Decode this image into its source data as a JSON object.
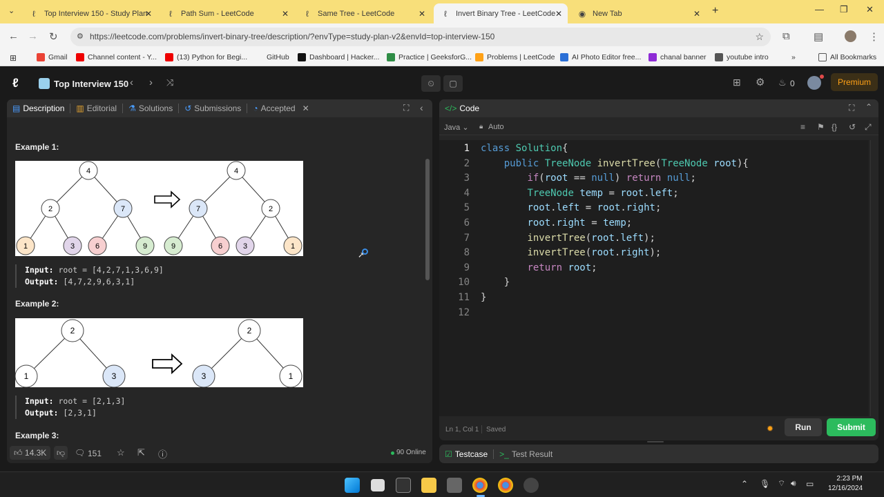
{
  "browser": {
    "tabs": [
      {
        "title": "Top Interview 150 - Study Plan",
        "active": false
      },
      {
        "title": "Path Sum - LeetCode",
        "active": false
      },
      {
        "title": "Same Tree - LeetCode",
        "active": false
      },
      {
        "title": "Invert Binary Tree - LeetCode",
        "active": true
      },
      {
        "title": "New Tab",
        "active": false
      }
    ],
    "url": "https://leetcode.com/problems/invert-binary-tree/description/?envType=study-plan-v2&envId=top-interview-150",
    "bookmarks": [
      "Gmail",
      "Channel content - Y...",
      "(13) Python for Begi...",
      "GitHub",
      "Dashboard | Hacker...",
      "Practice | GeeksforG...",
      "Problems | LeetCode",
      "AI Photo Editor free...",
      "chanal banner",
      "youtube intro"
    ],
    "all_bookmarks": "All Bookmarks"
  },
  "lc_nav": {
    "study_plan": "Top Interview 150",
    "streak": "0",
    "premium": "Premium"
  },
  "left_tabs": {
    "description": "Description",
    "editorial": "Editorial",
    "solutions": "Solutions",
    "submissions": "Submissions",
    "accepted": "Accepted"
  },
  "examples": [
    {
      "title": "Example 1:",
      "input_label": "Input:",
      "input_value": "root = [4,2,7,1,3,6,9]",
      "output_label": "Output:",
      "output_value": "[4,7,2,9,6,3,1]",
      "tree_before": [
        "4",
        "2",
        "7",
        "1",
        "3",
        "6",
        "9"
      ],
      "tree_after": [
        "4",
        "7",
        "2",
        "9",
        "6",
        "3",
        "1"
      ]
    },
    {
      "title": "Example 2:",
      "input_label": "Input:",
      "input_value": "root = [2,1,3]",
      "output_label": "Output:",
      "output_value": "[2,3,1]",
      "tree_before": [
        "2",
        "1",
        "3"
      ],
      "tree_after": [
        "2",
        "3",
        "1"
      ]
    },
    {
      "title": "Example 3:"
    }
  ],
  "left_footer": {
    "likes": "14.3K",
    "comments": "151",
    "online": "90 Online"
  },
  "code_panel": {
    "title": "Code",
    "language": "Java",
    "auto": "Auto",
    "status": "Ln 1, Col 1",
    "saved": "Saved",
    "run": "Run",
    "submit": "Submit",
    "lines": [
      "class Solution{",
      "    public TreeNode invertTree(TreeNode root){",
      "        if(root == null) return null;",
      "        TreeNode temp = root.left;",
      "        root.left = root.right;",
      "        root.right = temp;",
      "        invertTree(root.left);",
      "        invertTree(root.right);",
      "        return root;",
      "    }",
      "}",
      ""
    ]
  },
  "bottom_tabs": {
    "testcase": "Testcase",
    "test_result": "Test Result"
  },
  "taskbar": {
    "time": "2:23 PM",
    "date": "12/16/2024"
  }
}
